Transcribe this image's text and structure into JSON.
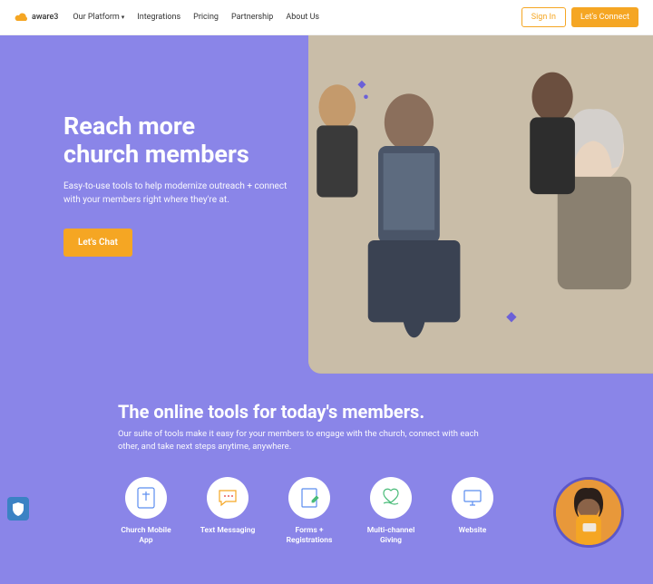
{
  "brand": "aware3",
  "nav": {
    "items": [
      "Our Platform",
      "Integrations",
      "Pricing",
      "Partnership",
      "About Us"
    ]
  },
  "header": {
    "signin": "Sign In",
    "connect": "Let's Connect"
  },
  "hero": {
    "title_line1": "Reach more",
    "title_line2": "church members",
    "subtitle": "Easy-to-use tools to help modernize outreach + connect with your members right where they're at.",
    "cta": "Let's Chat"
  },
  "section2": {
    "title": "The online tools for today's members.",
    "subtitle": "Our suite of tools make it easy for your members to engage with the church, connect with each other, and take next steps anytime, anywhere."
  },
  "features": [
    {
      "label": "Church Mobile App"
    },
    {
      "label": "Text Messaging"
    },
    {
      "label": "Forms + Registrations"
    },
    {
      "label": "Multi-channel Giving"
    },
    {
      "label": "Website"
    }
  ]
}
